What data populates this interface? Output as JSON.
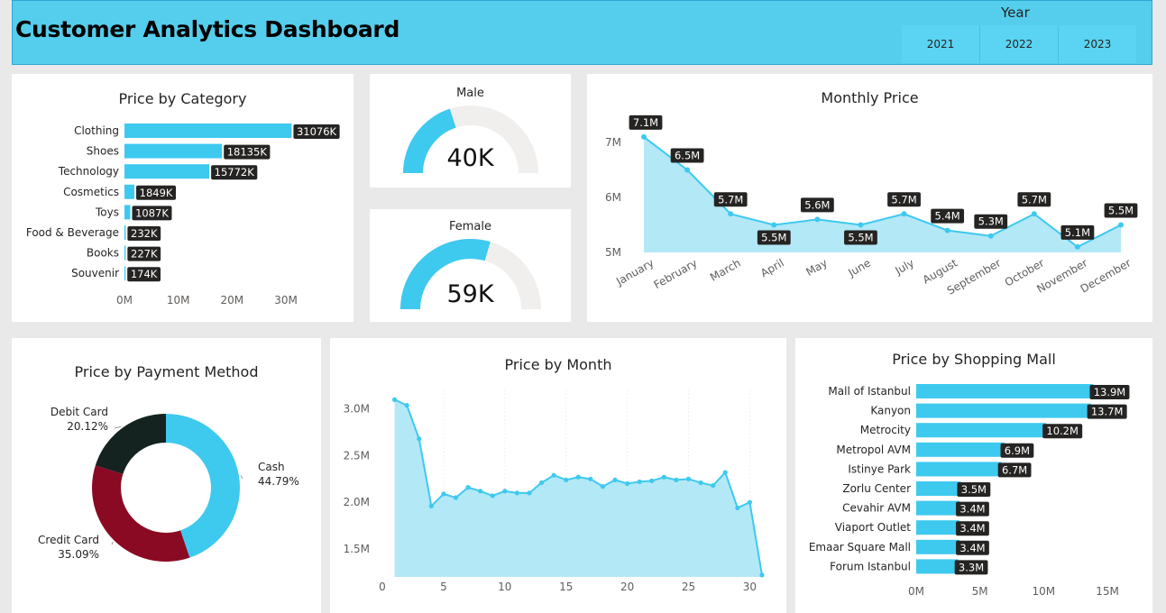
{
  "header": {
    "title": "Customer Analytics Dashboard",
    "year_label": "Year",
    "years": [
      "2021",
      "2022",
      "2023"
    ]
  },
  "colors": {
    "accent": "#3ec9ef",
    "area": "#b3e8f6",
    "dark": "#14231f",
    "red": "#8b0a23",
    "label_bg": "#252423"
  },
  "category": {
    "title": "Price by Category",
    "chart_data": {
      "type": "bar",
      "categories": [
        "Clothing",
        "Shoes",
        "Technology",
        "Cosmetics",
        "Toys",
        "Food & Beverage",
        "Books",
        "Souvenir"
      ],
      "values": [
        31076,
        18135,
        15772,
        1849,
        1087,
        232,
        227,
        174
      ],
      "labels": [
        "31076K",
        "18135K",
        "15772K",
        "1849K",
        "1087K",
        "232K",
        "227K",
        "174K"
      ],
      "xticks": [
        "0M",
        "10M",
        "20M",
        "30M"
      ],
      "xlim": [
        0,
        30000
      ]
    }
  },
  "gauges": {
    "male": {
      "label": "Male",
      "value": "40K",
      "fraction": 0.4
    },
    "female": {
      "label": "Female",
      "value": "59K",
      "fraction": 0.59
    }
  },
  "monthly": {
    "title": "Monthly Price",
    "chart_data": {
      "type": "area",
      "categories": [
        "January",
        "February",
        "March",
        "April",
        "May",
        "June",
        "July",
        "August",
        "September",
        "October",
        "November",
        "December"
      ],
      "values": [
        7.1,
        6.5,
        5.7,
        5.5,
        5.6,
        5.5,
        5.7,
        5.4,
        5.3,
        5.7,
        5.1,
        5.5
      ],
      "labels": [
        "7.1M",
        "6.5M",
        "5.7M",
        "5.5M",
        "5.6M",
        "5.5M",
        "5.7M",
        "5.4M",
        "5.3M",
        "5.7M",
        "5.1M",
        "5.5M"
      ],
      "yticks": [
        "5M",
        "6M",
        "7M"
      ],
      "ylim": [
        5,
        7
      ]
    }
  },
  "payment": {
    "title": "Price by Payment Method",
    "chart_data": {
      "type": "pie",
      "categories": [
        "Cash",
        "Credit Card",
        "Debit Card"
      ],
      "values": [
        44.79,
        35.09,
        20.12
      ],
      "percent_labels": [
        "44.79%",
        "35.09%",
        "20.12%"
      ],
      "colors": [
        "#3ec9ef",
        "#8b0a23",
        "#14231f"
      ]
    }
  },
  "bymonth": {
    "title": "Price by Month",
    "chart_data": {
      "type": "area",
      "x": [
        1,
        2,
        3,
        4,
        5,
        6,
        7,
        8,
        9,
        10,
        11,
        12,
        13,
        14,
        15,
        16,
        17,
        18,
        19,
        20,
        21,
        22,
        23,
        24,
        25,
        26,
        27,
        28,
        29,
        30,
        31
      ],
      "values": [
        3.1,
        3.04,
        2.68,
        1.96,
        2.09,
        2.05,
        2.16,
        2.12,
        2.07,
        2.12,
        2.1,
        2.1,
        2.21,
        2.29,
        2.24,
        2.27,
        2.25,
        2.17,
        2.24,
        2.2,
        2.22,
        2.23,
        2.27,
        2.24,
        2.25,
        2.21,
        2.18,
        2.32,
        1.94,
        2.0,
        1.22
      ],
      "yticks": [
        "1.5M",
        "2.0M",
        "2.5M",
        "3.0M"
      ],
      "xticks": [
        "0",
        "5",
        "10",
        "15",
        "20",
        "25",
        "30"
      ],
      "ylim": [
        1.2,
        3.2
      ],
      "xlim": [
        0,
        31
      ]
    }
  },
  "mall": {
    "title": "Price by Shopping Mall",
    "chart_data": {
      "type": "bar",
      "categories": [
        "Mall of Istanbul",
        "Kanyon",
        "Metrocity",
        "Metropol AVM",
        "Istinye Park",
        "Zorlu Center",
        "Cevahir AVM",
        "Viaport Outlet",
        "Emaar Square Mall",
        "Forum Istanbul"
      ],
      "values": [
        13.9,
        13.7,
        10.2,
        6.9,
        6.7,
        3.5,
        3.4,
        3.4,
        3.4,
        3.3
      ],
      "labels": [
        "13.9M",
        "13.7M",
        "10.2M",
        "6.9M",
        "6.7M",
        "3.5M",
        "3.4M",
        "3.4M",
        "3.4M",
        "3.3M"
      ],
      "xticks": [
        "0M",
        "5M",
        "10M",
        "15M"
      ],
      "xlim": [
        0,
        15
      ]
    }
  }
}
